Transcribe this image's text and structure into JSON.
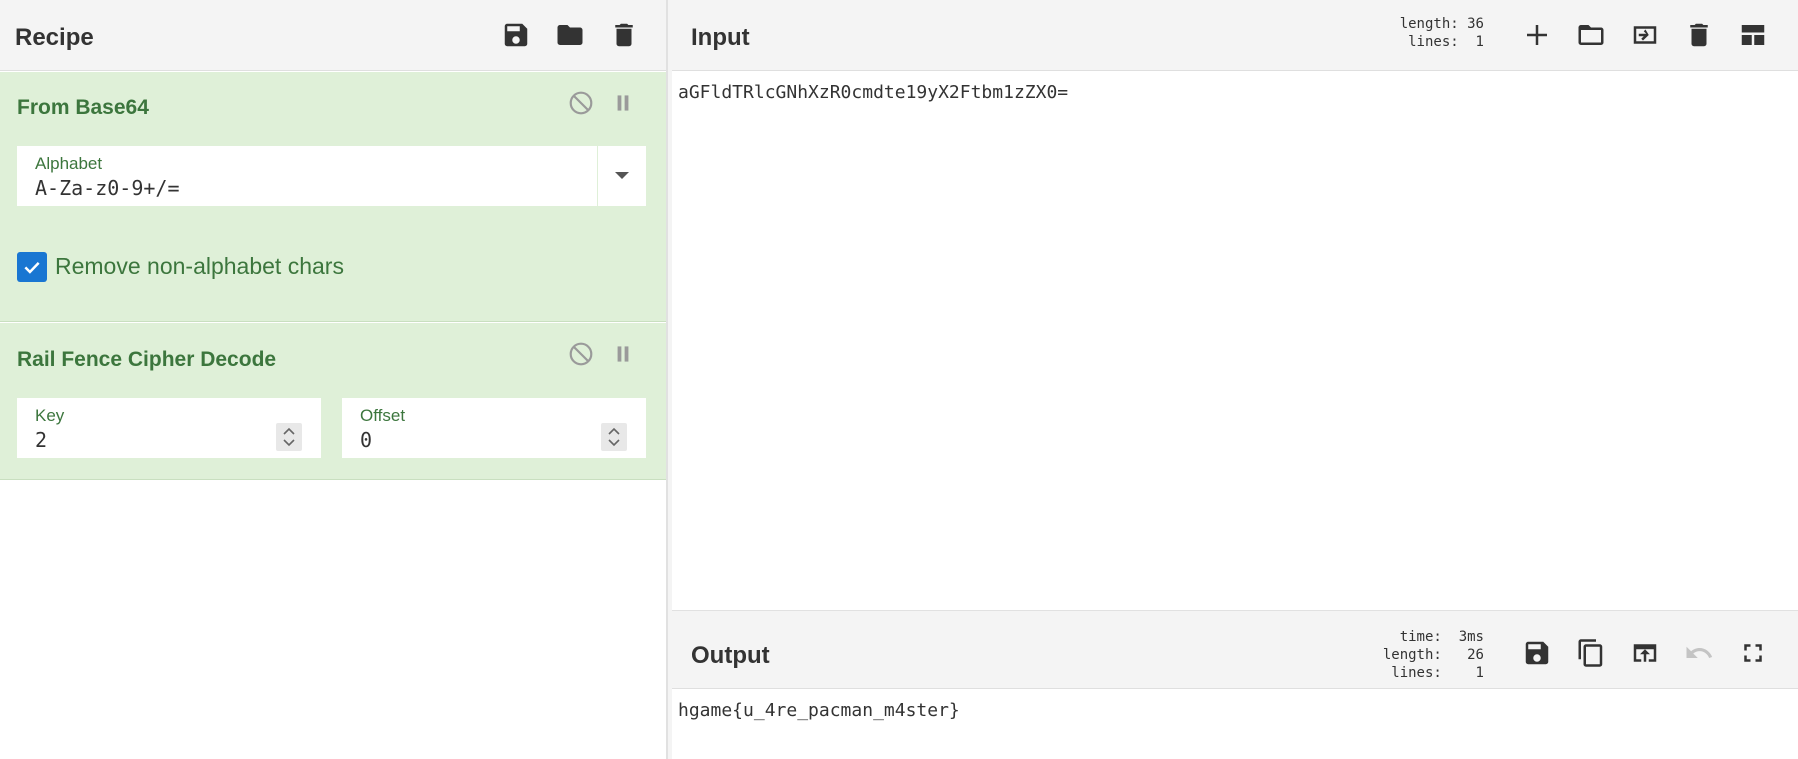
{
  "recipe": {
    "title": "Recipe",
    "icons": [
      "save-icon",
      "folder-open-icon",
      "trash-icon"
    ],
    "operations": [
      {
        "title": "From Base64",
        "fields": {
          "alphabet": {
            "label": "Alphabet",
            "value": "A-Za-z0-9+/="
          }
        },
        "checkbox": {
          "label": "Remove non-alphabet chars",
          "checked": true
        }
      },
      {
        "title": "Rail Fence Cipher Decode",
        "fields": {
          "key": {
            "label": "Key",
            "value": "2"
          },
          "offset": {
            "label": "Offset",
            "value": "0"
          }
        }
      }
    ]
  },
  "input": {
    "title": "Input",
    "stats": "length: 36\n lines:  1",
    "value": "aGFldTRlcGNhXzR0cmdte19yX2Ftbm1zZX0=",
    "icons": [
      "plus-icon",
      "folder-open-icon",
      "import-icon",
      "trash-icon",
      "layout-icon"
    ]
  },
  "output": {
    "title": "Output",
    "stats": "  time:  3ms\nlength:   26\n lines:    1",
    "value": "hgame{u_4re_pacman_m4ster}",
    "icons": [
      "save-icon",
      "copy-icon",
      "open-in-input-icon",
      "undo-icon",
      "maximize-icon"
    ]
  },
  "colors": {
    "op_bg": "#dff0d8",
    "op_text": "#3c763d",
    "checkbox": "#1976d2",
    "header_bg": "#f4f4f4"
  }
}
